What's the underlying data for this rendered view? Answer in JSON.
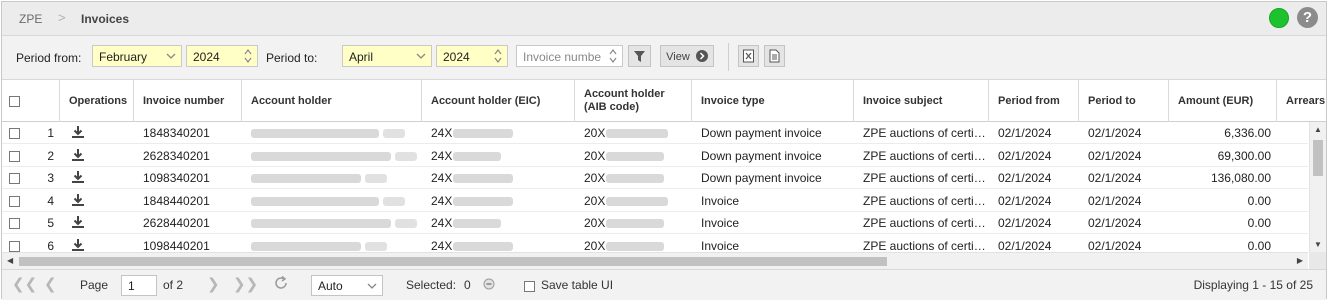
{
  "breadcrumb": {
    "root": "ZPE",
    "separator": ">",
    "current": "Invoices"
  },
  "status": {
    "color": "#1ec22e"
  },
  "help": {
    "label": "?"
  },
  "filters": {
    "period_from_label": "Period from:",
    "period_from_month": "February",
    "period_from_year": "2024",
    "period_to_label": "Period to:",
    "period_to_month": "April",
    "period_to_year": "2024",
    "invoice_number_placeholder": "Invoice numbe",
    "view_label": "View",
    "export_xls_icon": "excel-export-icon",
    "export_doc_icon": "document-export-icon"
  },
  "columns": [
    "Operations",
    "Invoice number",
    "Account holder",
    "Account holder (EIC)",
    "Account holder\n(AIB code)",
    "Invoice type",
    "Invoice subject",
    "Period from",
    "Period to",
    "Amount (EUR)",
    "Arrears"
  ],
  "rows": [
    {
      "index": "1",
      "invoice_number": "1848340201",
      "eic": "24X",
      "aib": "20X",
      "type": "Down payment invoice",
      "subject": "ZPE auctions of certificates",
      "from": "02/1/2024",
      "to": "02/1/2024",
      "amount": "6,336.00"
    },
    {
      "index": "2",
      "invoice_number": "2628340201",
      "eic": "24X",
      "aib": "20X",
      "type": "Down payment invoice",
      "subject": "ZPE auctions of certificates",
      "from": "02/1/2024",
      "to": "02/1/2024",
      "amount": "69,300.00"
    },
    {
      "index": "3",
      "invoice_number": "1098340201",
      "eic": "24X",
      "aib": "20X",
      "type": "Down payment invoice",
      "subject": "ZPE auctions of certificates",
      "from": "02/1/2024",
      "to": "02/1/2024",
      "amount": "136,080.00"
    },
    {
      "index": "4",
      "invoice_number": "1848440201",
      "eic": "24X",
      "aib": "20X",
      "type": "Invoice",
      "subject": "ZPE auctions of certificates",
      "from": "02/1/2024",
      "to": "02/1/2024",
      "amount": "0.00"
    },
    {
      "index": "5",
      "invoice_number": "2628440201",
      "eic": "24X",
      "aib": "20X",
      "type": "Invoice",
      "subject": "ZPE auctions of certificates",
      "from": "02/1/2024",
      "to": "02/1/2024",
      "amount": "0.00"
    },
    {
      "index": "6",
      "invoice_number": "1098440201",
      "eic": "24X",
      "aib": "20X",
      "type": "Invoice",
      "subject": "ZPE auctions of certificates",
      "from": "02/1/2024",
      "to": "02/1/2024",
      "amount": "0.00"
    }
  ],
  "pager": {
    "page_label": "Page",
    "page_value": "1",
    "of_label": "of 2",
    "page_size": "Auto",
    "selected_label": "Selected:",
    "selected_count": "0",
    "save_ui_label": "Save table UI",
    "displaying": "Displaying 1 - 15 of 25"
  }
}
